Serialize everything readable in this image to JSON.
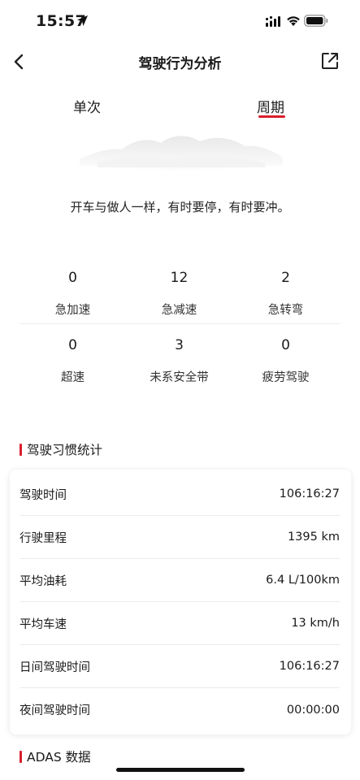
{
  "status_bar": {
    "time": "15:57"
  },
  "nav": {
    "title": "驾驶行为分析"
  },
  "tabs": [
    {
      "label": "单次",
      "active": false
    },
    {
      "label": "周期",
      "active": true
    }
  ],
  "accent_color": "#d81e2c",
  "slogan": "开车与做人一样，有时要停，有时要冲。",
  "event_stats": [
    {
      "value": "0",
      "label": "急加速"
    },
    {
      "value": "12",
      "label": "急减速"
    },
    {
      "value": "2",
      "label": "急转弯"
    },
    {
      "value": "0",
      "label": "超速"
    },
    {
      "value": "3",
      "label": "未系安全带"
    },
    {
      "value": "0",
      "label": "疲劳驾驶"
    }
  ],
  "habits": {
    "title": "驾驶习惯统计",
    "rows": [
      {
        "label": "驾驶时间",
        "value": "106:16:27"
      },
      {
        "label": "行驶里程",
        "value": "1395 km"
      },
      {
        "label": "平均油耗",
        "value": "6.4 L/100km"
      },
      {
        "label": "平均车速",
        "value": "13 km/h"
      },
      {
        "label": "日间驾驶时间",
        "value": "106:16:27"
      },
      {
        "label": "夜间驾驶时间",
        "value": "00:00:00"
      }
    ]
  },
  "adas": {
    "title": "ADAS 数据"
  }
}
